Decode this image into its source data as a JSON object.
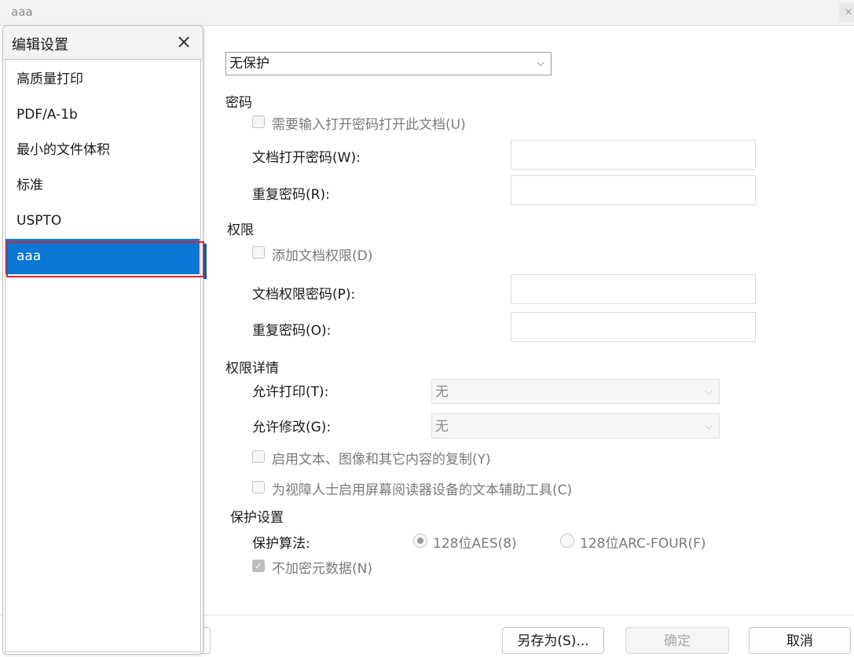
{
  "window": {
    "title": "aaa",
    "close_glyph": "×"
  },
  "popup": {
    "title": "编辑设置",
    "close_glyph": "×",
    "items": [
      {
        "label": "高质量打印"
      },
      {
        "label": "PDF/A-1b"
      },
      {
        "label": "最小的文件体积"
      },
      {
        "label": "标准"
      },
      {
        "label": "USPTO"
      },
      {
        "label": "aaa",
        "selected": true
      }
    ]
  },
  "protection_select": {
    "value": "无保护",
    "chevron": "⌵"
  },
  "password": {
    "section": "密码",
    "require_checkbox": "需要输入打开密码打开此文档(U)",
    "open_label": "文档打开密码(W):",
    "repeat_label": "重复密码(R):"
  },
  "permissions": {
    "section": "权限",
    "add_checkbox": "添加文档权限(D)",
    "perm_label": "文档权限密码(P):",
    "repeat_label": "重复密码(O):"
  },
  "details": {
    "section": "权限详情",
    "print_label": "允许打印(T):",
    "print_value": "无",
    "modify_label": "允许修改(G):",
    "modify_value": "无",
    "copy_checkbox": "启用文本、图像和其它内容的复制(Y)",
    "access_checkbox": "为视障人士启用屏幕阅读器设备的文本辅助工具(C)"
  },
  "protect": {
    "section": "保护设置",
    "algo_label": "保护算法:",
    "algo_aes": "128位AES(8)",
    "algo_rc4": "128位ARC-FOUR(F)",
    "no_encrypt_meta": "不加密元数据(N)",
    "check_glyph": "✓"
  },
  "buttons": {
    "save_as": "另存为(S)...",
    "ok": "确定",
    "cancel": "取消"
  },
  "colors": {
    "accent": "#0a78d4",
    "highlight": "#e0202a"
  }
}
